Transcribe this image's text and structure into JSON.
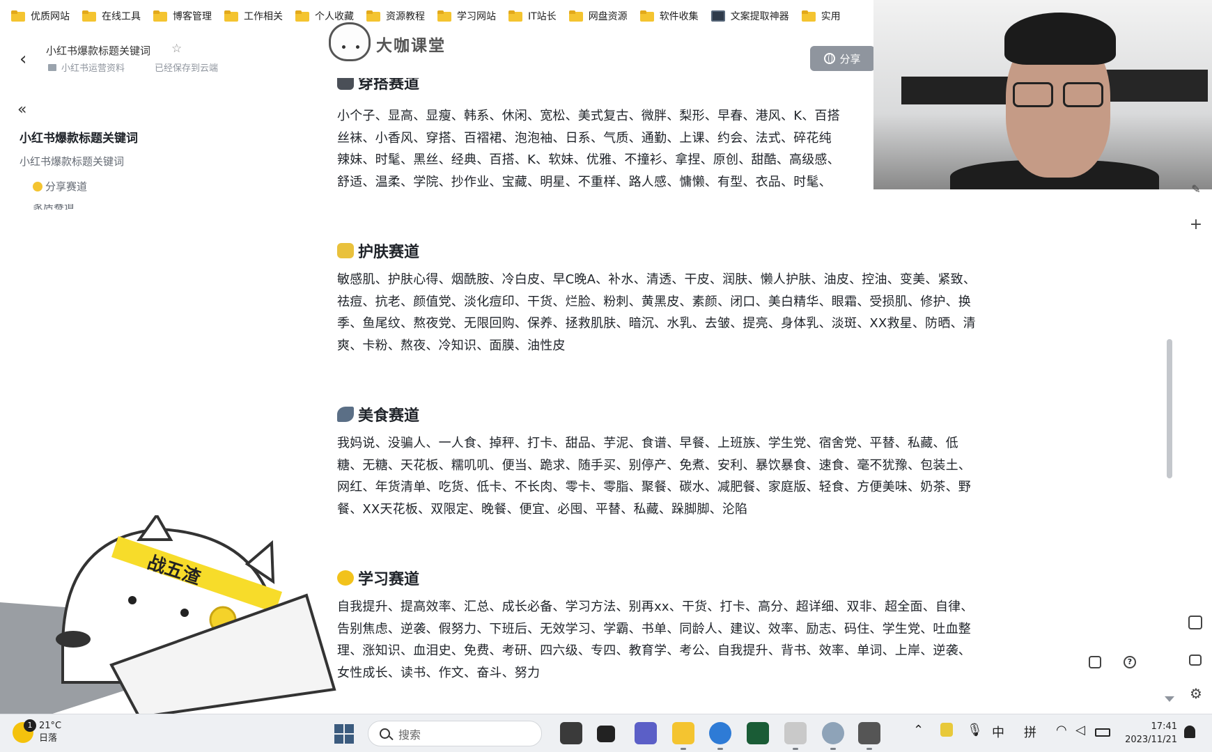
{
  "bookmarks": [
    {
      "label": "优质网站",
      "icon": "folder-icon"
    },
    {
      "label": "在线工具",
      "icon": "folder-icon"
    },
    {
      "label": "博客管理",
      "icon": "folder-icon"
    },
    {
      "label": "工作相关",
      "icon": "folder-icon"
    },
    {
      "label": "个人收藏",
      "icon": "folder-icon"
    },
    {
      "label": "资源教程",
      "icon": "folder-icon"
    },
    {
      "label": "学习网站",
      "icon": "folder-icon"
    },
    {
      "label": "IT站长",
      "icon": "folder-icon"
    },
    {
      "label": "网盘资源",
      "icon": "folder-icon"
    },
    {
      "label": "软件收集",
      "icon": "folder-icon"
    },
    {
      "label": "文案提取神器",
      "icon": "app-icon"
    },
    {
      "label": "实用",
      "icon": "folder-icon"
    }
  ],
  "header": {
    "doc_title": "小红书爆款标题关键词",
    "location": "小红书运营资料",
    "saved_status": "已经保存到云端",
    "share_label": "分享"
  },
  "logo": {
    "text": "大咖课堂"
  },
  "sidebar": {
    "title": "小红书爆款标题关键词",
    "subtitle": "小红书爆款标题关键词",
    "items": [
      {
        "label": "分享赛道"
      },
      {
        "label": "家居赛道"
      }
    ]
  },
  "sections": [
    {
      "title": "穿搭赛道",
      "lines": [
        "小个子、显高、显瘦、韩系、休闲、宽松、美式复古、微胖、梨形、早春、港风、K、百搭",
        "丝袜、小香风、穿搭、百褶裙、泡泡袖、日系、气质、通勤、上课、约会、法式、碎花纯",
        "辣妹、时髦、黑丝、经典、百搭、K、软妹、优雅、不撞衫、拿捏、原创、甜酷、高级感、",
        "舒适、温柔、学院、抄作业、宝藏、明星、不重样、路人感、慵懒、有型、衣品、时髦、"
      ]
    },
    {
      "title": "护肤赛道",
      "lines": [
        "敏感肌、护肤心得、烟酰胺、冷白皮、早C晚A、补水、清透、干皮、润肤、懒人护肤、油皮、控油、变美、紧致、",
        "祛痘、抗老、颜值党、淡化痘印、干货、烂脸、粉刺、黄黑皮、素颜、闭口、美白精华、眼霜、受损肌、修护、换",
        "季、鱼尾纹、熬夜党、无限回购、保养、拯救肌肤、暗沉、水乳、去皱、提亮、身体乳、淡斑、XX救星、防晒、清",
        "爽、卡粉、熬夜、冷知识、面膜、油性皮"
      ]
    },
    {
      "title": "美食赛道",
      "lines": [
        "我妈说、没骗人、一人食、掉秤、打卡、甜品、芋泥、食谱、早餐、上班族、学生党、宿舍党、平替、私藏、低",
        "糖、无糖、天花板、糯叽叽、便当、跪求、随手买、别停产、免煮、安利、暴饮暴食、速食、毫不犹豫、包装土、",
        "网红、年货清单、吃货、低卡、不长肉、零卡、零脂、聚餐、碳水、减肥餐、家庭版、轻食、方便美味、奶茶、野",
        "餐、XX天花板、双限定、晚餐、便宜、必囤、平替、私藏、跺脚脚、沦陷"
      ]
    },
    {
      "title": "学习赛道",
      "lines": [
        "自我提升、提高效率、汇总、成长必备、学习方法、别再xx、干货、打卡、高分、超详细、双非、超全面、自律、",
        "告别焦虑、逆袭、假努力、下班后、无效学习、学霸、书单、同龄人、建议、效率、励志、码住、学生党、吐血整",
        "理、涨知识、血泪史、免费、考研、四六级、专四、教育学、考公、自我提升、背书、效率、单词、上岸、逆袭、",
        "女性成长、读书、作文、奋斗、努力"
      ]
    }
  ],
  "mascot": {
    "headband_text": "战五渣"
  },
  "taskbar": {
    "weather_temp": "21°C",
    "weather_desc": "日落",
    "notification_count": "1",
    "search_placeholder": "搜索",
    "ime_lang": "中",
    "ime_mode": "拼",
    "time": "17:41",
    "date": "2023/11/21"
  },
  "colors": {
    "accent_share": "#8f959e",
    "folder": "#f4c430",
    "text_primary": "#1f2329",
    "text_secondary": "#646a73"
  }
}
